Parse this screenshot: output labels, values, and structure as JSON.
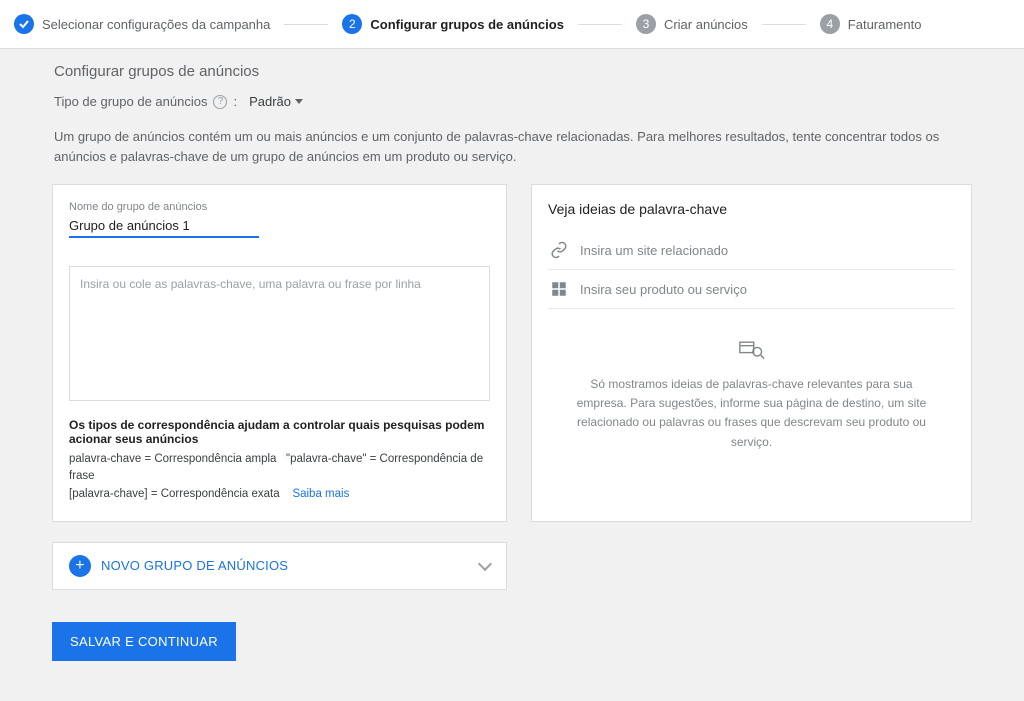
{
  "stepper": {
    "steps": [
      {
        "num": "✓",
        "label": "Selecionar configurações da campanha",
        "state": "done"
      },
      {
        "num": "2",
        "label": "Configurar grupos de anúncios",
        "state": "current"
      },
      {
        "num": "3",
        "label": "Criar anúncios",
        "state": "future"
      },
      {
        "num": "4",
        "label": "Faturamento",
        "state": "future"
      }
    ]
  },
  "section": {
    "title": "Configurar grupos de anúncios",
    "type_label": "Tipo de grupo de anúncios",
    "type_colon": ":",
    "type_value": "Padrão",
    "intro": "Um grupo de anúncios contém um ou mais anúncios e um conjunto de palavras-chave relacionadas. Para melhores resultados, tente concentrar todos os anúncios e palavras-chave de um grupo de anúncios em um produto ou serviço."
  },
  "left": {
    "name_label": "Nome do grupo de anúncios",
    "name_value": "Grupo de anúncios 1",
    "kw_placeholder": "Insira ou cole as palavras-chave, uma palavra ou frase por linha",
    "match_title": "Os tipos de correspondência ajudam a controlar quais pesquisas podem acionar seus anúncios",
    "match_line": "palavra-chave = Correspondência ampla   \"palavra-chave\" = Correspondência de frase\n[palavra-chave] = Correspondência exata   ",
    "learn_more": "Saiba mais"
  },
  "right": {
    "title": "Veja ideias de palavra-chave",
    "site_placeholder": "Insira um site relacionado",
    "product_placeholder": "Insira seu produto ou serviço",
    "empty": "Só mostramos ideias de palavras-chave relevantes para sua empresa. Para sugestões, informe sua página de destino, um site relacionado ou palavras ou frases que descrevam seu produto ou serviço."
  },
  "new_group": {
    "label": "NOVO GRUPO DE ANÚNCIOS"
  },
  "save": {
    "label": "SALVAR E CONTINUAR"
  }
}
